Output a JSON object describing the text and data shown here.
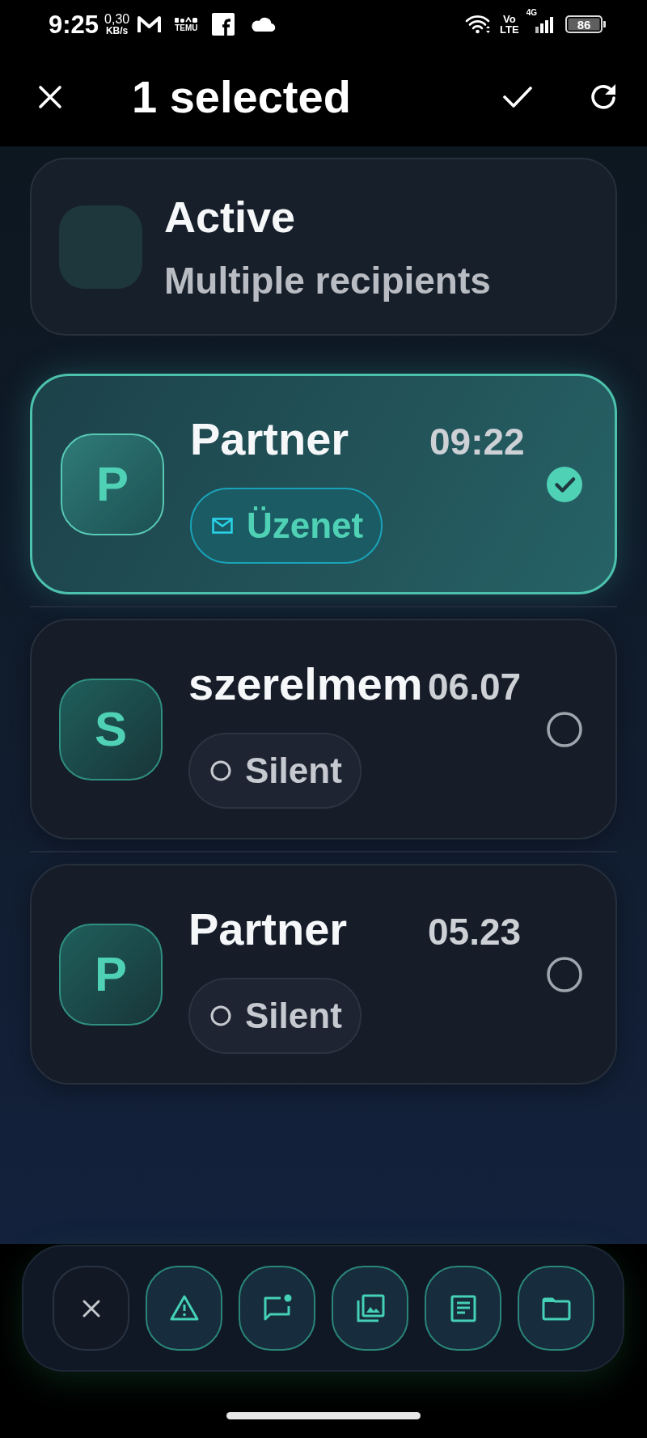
{
  "status_bar": {
    "time": "9:25",
    "speed_value": "0,30",
    "speed_unit": "KB/s",
    "notification_label": "TEMU",
    "volte": [
      "Vo",
      "LTE"
    ],
    "network_type": "4G",
    "battery": "86"
  },
  "top_bar": {
    "title": "1 selected"
  },
  "header_card": {
    "title": "Active",
    "subtitle": "Multiple recipients"
  },
  "conversations": [
    {
      "initial": "P",
      "name": "Partner",
      "time": "09:22",
      "tag": {
        "kind": "message",
        "label": "Üzenet"
      },
      "selected": true
    },
    {
      "initial": "S",
      "name": "szerelmem",
      "time": "06.07",
      "tag": {
        "kind": "silent",
        "label": "Silent"
      },
      "selected": false
    },
    {
      "initial": "P",
      "name": "Partner",
      "time": "05.23",
      "tag": {
        "kind": "silent",
        "label": "Silent"
      },
      "selected": false
    }
  ]
}
